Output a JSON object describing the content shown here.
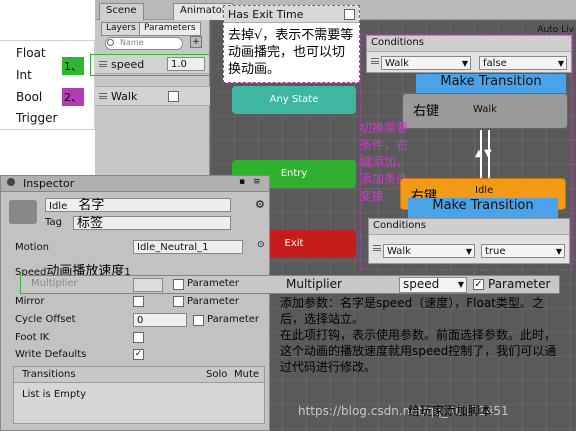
{
  "top_tabs": [
    "Scene",
    "Animator"
  ],
  "auto_live": "Auto Liv",
  "param_tabs": [
    "Layers",
    "Parameters"
  ],
  "search_placeholder": "Name",
  "params": [
    {
      "name": "speed",
      "value": "1.0",
      "label": "1、"
    },
    {
      "name": "Walk",
      "label": "2、"
    }
  ],
  "type_menu": [
    "Float",
    "Int",
    "Bool",
    "Trigger"
  ],
  "exit_popup": {
    "title": "Has Exit Time",
    "text": "去掉√，表示不需要等动画播完，也可以切换动画。"
  },
  "conditions_top": {
    "title": "Conditions",
    "param": "Walk",
    "value": "false"
  },
  "conditions_bottom": {
    "title": "Conditions",
    "param": "Walk",
    "value": "true"
  },
  "make_transition": "Make Transition",
  "states": {
    "any": "Any State",
    "entry": "Entry",
    "exit": "Exit",
    "walk": "Walk",
    "idle": "Idle"
  },
  "right_click": "右键",
  "purple_note": "切换需要条件，右键添加，添加条件变换",
  "inspector": {
    "title": "Inspector",
    "name": "Idle",
    "name_cn": "名字",
    "tag": "Tag",
    "tag_cn": "标签",
    "motion_label": "Motion",
    "motion_value": "Idle_Neutral_1",
    "speed_label": "Speed",
    "speed_cn": "动画播放速度",
    "speed_value": "1",
    "multiplier": "Multiplier",
    "parameter": "Parameter",
    "mirror": "Mirror",
    "cycle_offset": "Cycle Offset",
    "cycle_value": "0",
    "foot_ik": "Foot IK",
    "write_defaults": "Write Defaults",
    "transitions": "Transitions",
    "solo": "Solo",
    "mute": "Mute",
    "list_empty": "List is Empty"
  },
  "mult_zoom": {
    "label": "Multiplier",
    "param": "speed",
    "parameter": "Parameter"
  },
  "note": "添加参数：名字是speed（速度），Float类型。之后，选择站立。\n在此项打钩，表示使用参数。前面选择参数。此时，这个动画的播放速度就用speed控制了，我们可以通过代码进行修改。",
  "add_script": "给玩家添加脚本",
  "watermark": "https://blog.csdn.net/qq_40131451",
  "colors": {
    "any_state": "#3fb6a0",
    "entry": "#2fb02f",
    "exit": "#c51c1c",
    "idle": "#f29a16",
    "transition": "#4aa3e8",
    "highlight_purple": "#b23db2",
    "highlight_green": "#2db82d"
  }
}
